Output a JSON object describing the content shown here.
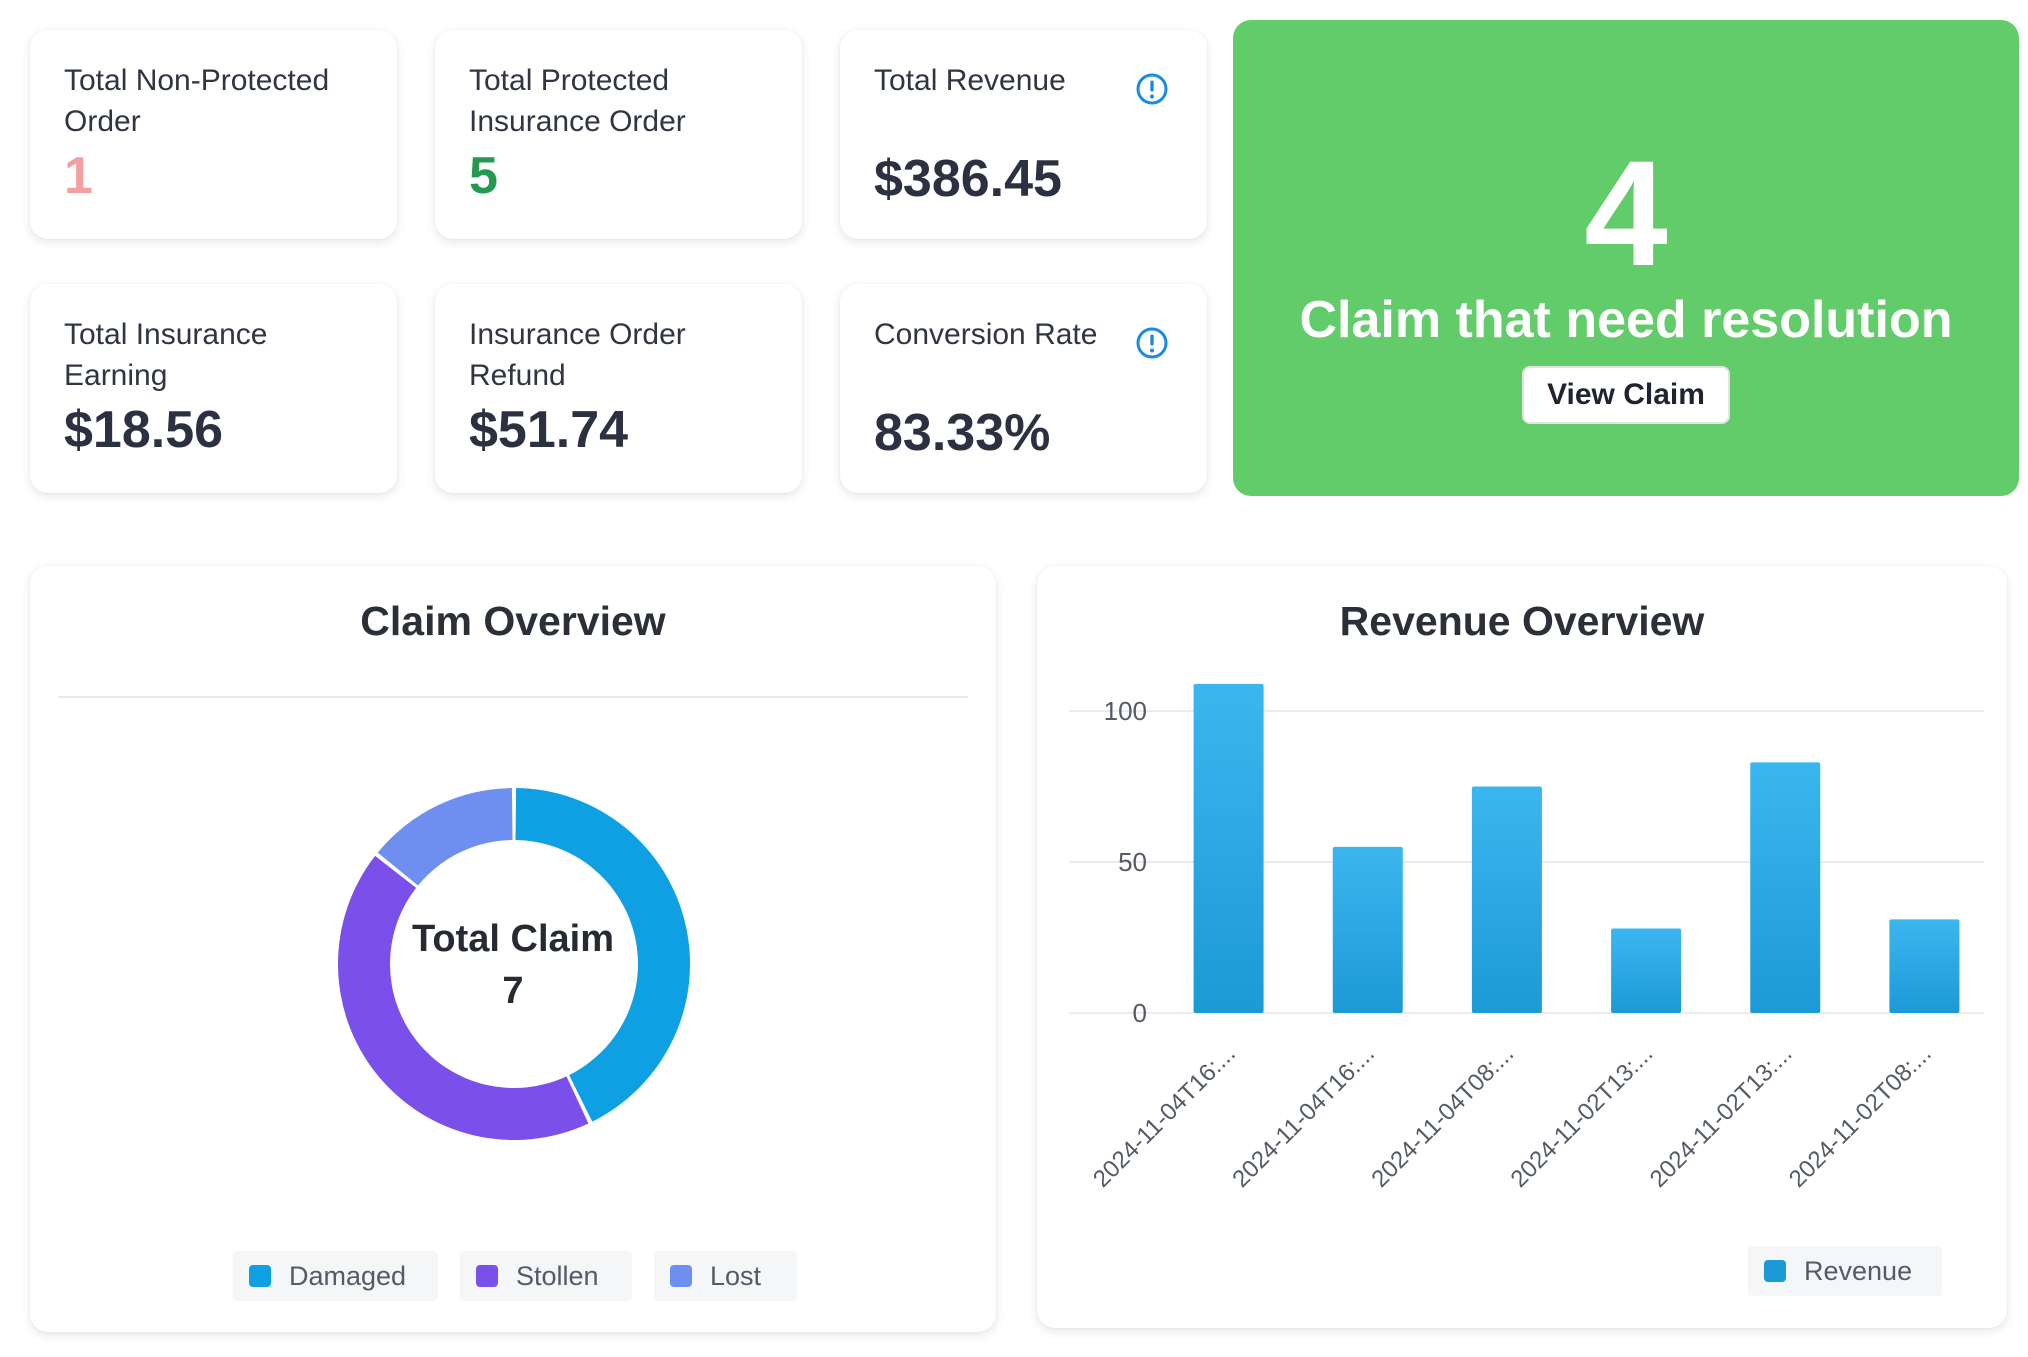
{
  "stats": {
    "non_protected": {
      "label": "Total Non-Protected Order",
      "value": "1"
    },
    "protected": {
      "label": "Total Protected Insurance Order",
      "value": "5"
    },
    "revenue": {
      "label": "Total Revenue",
      "value": "$386.45"
    },
    "insurance_earning": {
      "label": "Total Insurance Earning",
      "value": "$18.56"
    },
    "refund": {
      "label": "Insurance Order Refund",
      "value": "$51.74"
    },
    "conversion": {
      "label": "Conversion Rate",
      "value": "83.33%"
    }
  },
  "hero": {
    "count": "4",
    "message": "Claim that need resolution",
    "button": "View Claim",
    "bg_color": "#63cc6a"
  },
  "icons": {
    "info": "info-circle-icon"
  },
  "claim_overview": {
    "title": "Claim Overview",
    "center_label": "Total Claim",
    "center_value": "7"
  },
  "revenue_overview": {
    "title": "Revenue Overview"
  },
  "chart_data": [
    {
      "type": "pie",
      "title": "Claim Overview",
      "categories": [
        "Damaged",
        "Stollen",
        "Lost"
      ],
      "values": [
        3,
        3,
        1
      ],
      "colors": [
        "#0ea0e2",
        "#7b4fea",
        "#6e8ff0"
      ],
      "legend": "bottom"
    },
    {
      "type": "bar",
      "title": "Revenue Overview",
      "categories": [
        "2024-11-04T16:...",
        "2024-11-04T16:...",
        "2024-11-04T08:...",
        "2024-11-02T13:...",
        "2024-11-02T13:...",
        "2024-11-02T08:..."
      ],
      "series": [
        {
          "name": "Revenue",
          "values": [
            109,
            55,
            75,
            28,
            83,
            31
          ]
        }
      ],
      "ylim": [
        0,
        100
      ],
      "yticks": [
        0,
        50,
        100
      ],
      "grid": true,
      "legend": "bottom-right",
      "colors": [
        "#3bb6ef",
        "#1c9ad6"
      ]
    }
  ]
}
